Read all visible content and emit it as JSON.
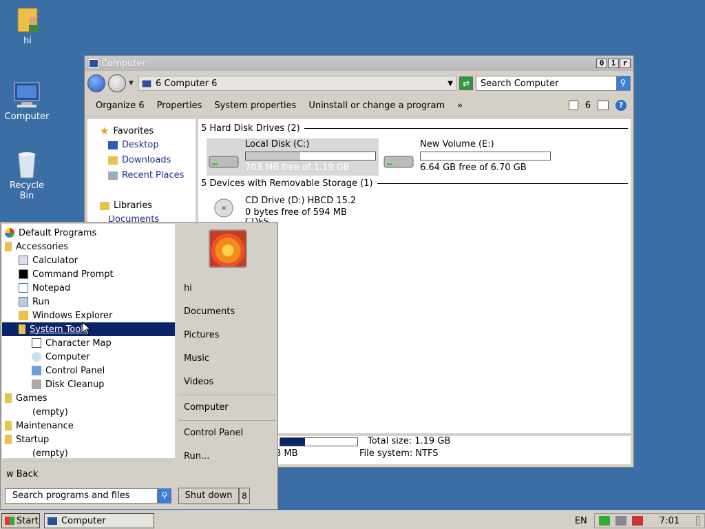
{
  "desktop": {
    "icons": [
      {
        "label": "hi"
      },
      {
        "label": "Computer"
      },
      {
        "label": "Recycle\nBin",
        "line1": "Recycle",
        "line2": "Bin"
      }
    ]
  },
  "window": {
    "title": "Computer",
    "controls": [
      "0",
      "1",
      "r"
    ],
    "address": "6  Computer 6",
    "search_placeholder": "Search Computer",
    "commands": [
      "Organize 6",
      "Properties",
      "System properties",
      "Uninstall or change a program",
      "»"
    ],
    "view_label": "6",
    "nav": {
      "favorites": "Favorites",
      "desktop": "Desktop",
      "downloads": "Downloads",
      "recent": "Recent Places",
      "libraries": "Libraries",
      "documents": "Documents"
    },
    "groups": {
      "hdd": "5 Hard Disk Drives (2)",
      "removable": "5 Devices with Removable Storage (1)"
    },
    "drives": [
      {
        "name": "Local Disk (C:)",
        "free": "703 MB free of 1.19 GB",
        "used_fraction": 0.42
      },
      {
        "name": "New Volume (E:)",
        "free": "6.64 GB free of 6.70 GB",
        "used_fraction": 0.01
      },
      {
        "name": "CD Drive (D:) HBCD 15.2",
        "free": "0 bytes free of 594 MB",
        "fs": "CDFS"
      }
    ],
    "status": {
      "total": "Total size: 1.19 GB",
      "fs": "File system: NTFS",
      "free_fragment": "3 MB"
    }
  },
  "startmenu": {
    "items": [
      "Default Programs",
      "Accessories",
      "Calculator",
      "Command Prompt",
      "Notepad",
      "Run",
      "Windows Explorer",
      "System Tools",
      "Character Map",
      "Computer",
      "Control Panel",
      "Disk Cleanup",
      "Games",
      "(empty)",
      "Maintenance",
      "Startup",
      "(empty)"
    ],
    "back": "w  Back",
    "search_placeholder": "Search programs and files",
    "right": [
      "hi",
      "Documents",
      "Pictures",
      "Music",
      "Videos",
      "Computer",
      "Control Panel",
      "Run..."
    ],
    "shutdown": "Shut down",
    "shutdown_arrow": "8"
  },
  "taskbar": {
    "start": "Start",
    "task": "Computer",
    "lang": "EN",
    "time": "7:01"
  }
}
